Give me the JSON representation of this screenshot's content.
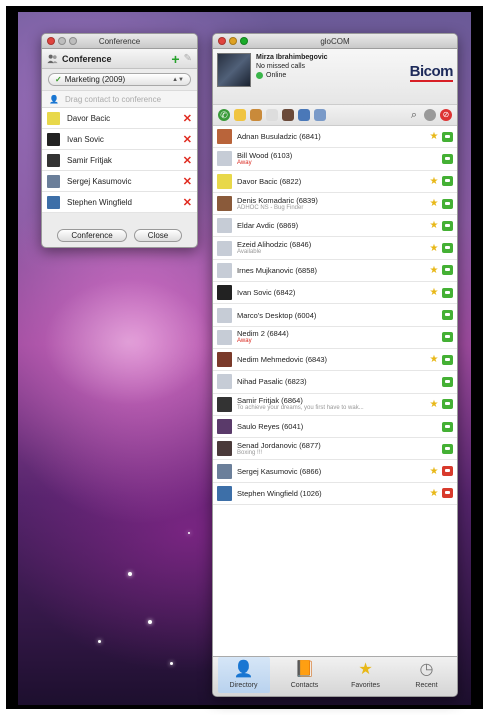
{
  "conference_window": {
    "title": "Conference",
    "header_title": "Conference",
    "group_select": "Marketing (2009)",
    "drag_placeholder": "Drag contact to conference",
    "participants": [
      {
        "name": "Davor Bacic",
        "avatar_color": "#e8d84a"
      },
      {
        "name": "Ivan Sovic",
        "avatar_color": "#222222"
      },
      {
        "name": "Samir Fritjak",
        "avatar_color": "#333333"
      },
      {
        "name": "Sergej Kasumovic",
        "avatar_color": "#6b7f9a"
      },
      {
        "name": "Stephen Wingfield",
        "avatar_color": "#3d6fa8"
      }
    ],
    "buttons": {
      "conference": "Conference",
      "close": "Close"
    }
  },
  "glocom_window": {
    "title": "gloCOM",
    "user": {
      "name": "Mirza Ibrahimbegovic",
      "missed": "No missed calls",
      "status": "Online"
    },
    "logo": "Bicom",
    "contacts": [
      {
        "name": "Adnan Busuladzic (6841)",
        "sub": "",
        "sub_red": false,
        "favorite": true,
        "phone": "green",
        "avatar_color": "#b9643a"
      },
      {
        "name": "Bill Wood (6103)",
        "sub": "Away",
        "sub_red": true,
        "favorite": false,
        "phone": "green",
        "avatar_color": "#c6ccd6"
      },
      {
        "name": "Davor Bacic (6822)",
        "sub": "",
        "sub_red": false,
        "favorite": true,
        "phone": "green",
        "avatar_color": "#e8d84a"
      },
      {
        "name": "Denis Komadaric (6839)",
        "sub": "ADHOC NS - Bug Finder",
        "sub_red": false,
        "favorite": true,
        "phone": "green",
        "avatar_color": "#8a5a3a"
      },
      {
        "name": "Eldar Avdic (6869)",
        "sub": "",
        "sub_red": false,
        "favorite": true,
        "phone": "green",
        "avatar_color": "#c6ccd6"
      },
      {
        "name": "Ezeid Alihodzic (6846)",
        "sub": "Available",
        "sub_red": false,
        "favorite": true,
        "phone": "green",
        "avatar_color": "#c6ccd6"
      },
      {
        "name": "Irnes Mujkanovic (6858)",
        "sub": "",
        "sub_red": false,
        "favorite": true,
        "phone": "green",
        "avatar_color": "#c6ccd6"
      },
      {
        "name": "Ivan Sovic (6842)",
        "sub": "",
        "sub_red": false,
        "favorite": true,
        "phone": "green",
        "avatar_color": "#222222"
      },
      {
        "name": "Marco's Desktop (6004)",
        "sub": "",
        "sub_red": false,
        "favorite": false,
        "phone": "green",
        "avatar_color": "#c6ccd6"
      },
      {
        "name": "Nedim 2 (6844)",
        "sub": "Away",
        "sub_red": true,
        "favorite": false,
        "phone": "green",
        "avatar_color": "#c6ccd6"
      },
      {
        "name": "Nedim Mehmedovic (6843)",
        "sub": "",
        "sub_red": false,
        "favorite": true,
        "phone": "green",
        "avatar_color": "#7a3a2a"
      },
      {
        "name": "Nihad Pasalic (6823)",
        "sub": "",
        "sub_red": false,
        "favorite": false,
        "phone": "green",
        "avatar_color": "#c6ccd6"
      },
      {
        "name": "Samir Fritjak (6864)",
        "sub": "To achieve your dreams, you first have to wak...",
        "sub_red": false,
        "favorite": true,
        "phone": "green",
        "avatar_color": "#333333"
      },
      {
        "name": "Saulo Reyes (6041)",
        "sub": "",
        "sub_red": false,
        "favorite": false,
        "phone": "green",
        "avatar_color": "#5a3a6a"
      },
      {
        "name": "Senad Jordanovic (6877)",
        "sub": "Boxing !!!",
        "sub_red": false,
        "favorite": false,
        "phone": "green",
        "avatar_color": "#4a3a3a"
      },
      {
        "name": "Sergej Kasumovic (6866)",
        "sub": "",
        "sub_red": false,
        "favorite": true,
        "phone": "red",
        "avatar_color": "#6b7f9a"
      },
      {
        "name": "Stephen Wingfield (1026)",
        "sub": "",
        "sub_red": false,
        "favorite": true,
        "phone": "red",
        "avatar_color": "#3d6fa8"
      }
    ],
    "bottom_tabs": [
      {
        "label": "Directory",
        "icon": "person-icon",
        "active": true
      },
      {
        "label": "Contacts",
        "icon": "address-book-icon",
        "active": false
      },
      {
        "label": "Favorites",
        "icon": "star-icon",
        "active": false
      },
      {
        "label": "Recent",
        "icon": "clock-icon",
        "active": false
      }
    ]
  }
}
